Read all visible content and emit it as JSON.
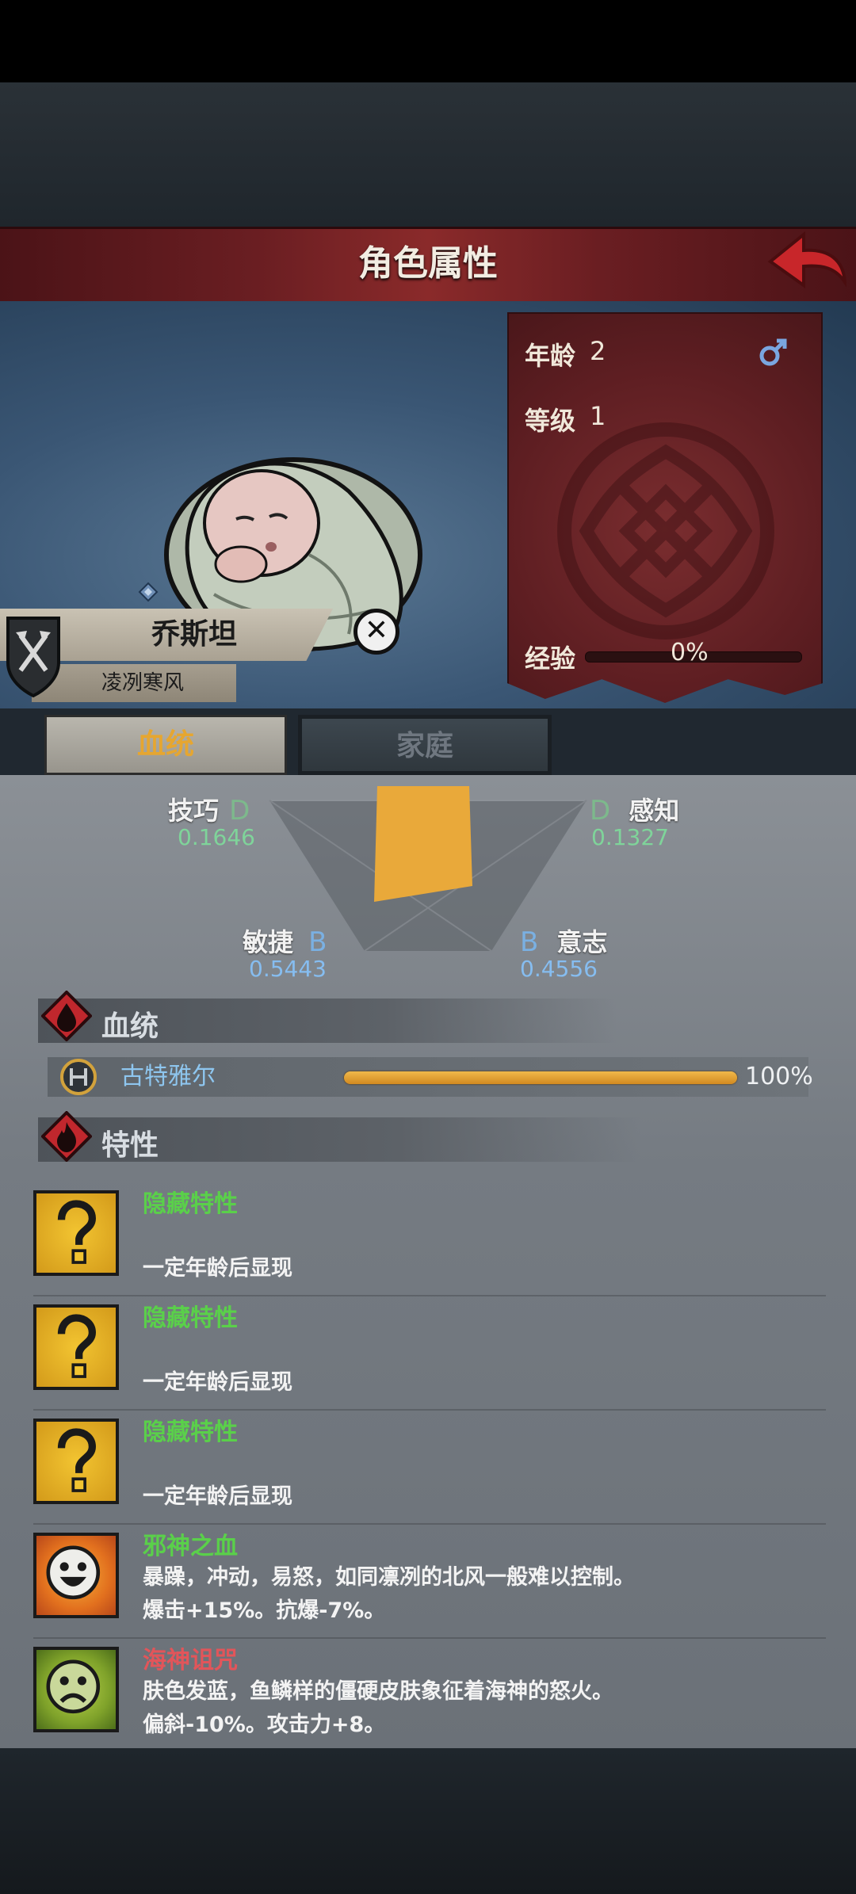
{
  "header": {
    "title": "角色属性"
  },
  "character": {
    "name": "乔斯坦",
    "subtitle": "凌冽寒风",
    "age_label": "年龄",
    "age_value": "2",
    "level_label": "等级",
    "level_value": "1",
    "exp_label": "经验",
    "exp_value": "0%",
    "exp_fraction": 0
  },
  "tabs": [
    {
      "label": "血统",
      "active": true
    },
    {
      "label": "家庭",
      "active": false
    }
  ],
  "stats": {
    "skill": {
      "name": "技巧",
      "grade": "D",
      "value": "0.1646"
    },
    "perception": {
      "name": "感知",
      "grade": "D",
      "value": "0.1327"
    },
    "agility": {
      "name": "敏捷",
      "grade": "B",
      "value": "0.5443"
    },
    "will": {
      "name": "意志",
      "grade": "B",
      "value": "0.4556"
    }
  },
  "sections": {
    "bloodline": "血统",
    "traits": "特性"
  },
  "bloodline": {
    "name": "古特雅尔",
    "percent": "100%",
    "fraction": 1.0
  },
  "traits": [
    {
      "name": "隐藏特性",
      "desc1": "",
      "desc2": "一定年龄后显现",
      "color": "green",
      "icon": "question-mark-icon"
    },
    {
      "name": "隐藏特性",
      "desc1": "",
      "desc2": "一定年龄后显现",
      "color": "green",
      "icon": "question-mark-icon"
    },
    {
      "name": "隐藏特性",
      "desc1": "",
      "desc2": "一定年龄后显现",
      "color": "green",
      "icon": "question-mark-icon"
    },
    {
      "name": "邪神之血",
      "desc1": "暴躁，冲动，易怒，如同凛冽的北风一般难以控制。",
      "desc2": "爆击+15%。抗爆-7%。",
      "color": "green",
      "icon": "happy-face-icon"
    },
    {
      "name": "海神诅咒",
      "desc1": "肤色发蓝，鱼鳞样的僵硬皮肤象征着海神的怒火。",
      "desc2": "偏斜-10%。攻击力+8。",
      "color": "red",
      "icon": "sad-face-icon"
    }
  ],
  "colors": {
    "header": "#6a1e22",
    "accent_gold": "#e9a93a",
    "trait_green": "#5ad04a",
    "trait_red": "#e2555a",
    "grade_d": "#7db98c",
    "grade_b": "#7ab0e2"
  }
}
